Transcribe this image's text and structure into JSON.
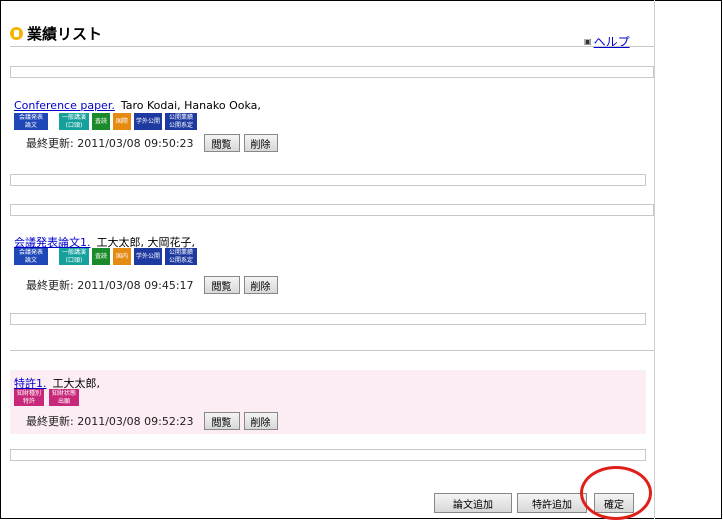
{
  "header": {
    "title": "業績リスト",
    "help_label": "ヘルプ",
    "help_icon": "help-icon"
  },
  "items": [
    {
      "title": "Conference paper.",
      "authors": "Taro Kodai,  Hanako Ooka,",
      "badges": [
        "会議発表 論文",
        "一般講演 (口頭)",
        "査読",
        "国際",
        "学外公開",
        "公開業績 公開系定"
      ],
      "updated_label": "最終更新:",
      "updated": "2011/03/08 09:50:23",
      "view_label": "閲覧",
      "delete_label": "削除"
    },
    {
      "title": "会議発表論文1.",
      "authors": "工大太郎, 大岡花子,",
      "badges": [
        "会議発表 論文",
        "一般講演 (口頭)",
        "査読",
        "国内",
        "学外公開",
        "公開業績 公開系定"
      ],
      "updated_label": "最終更新:",
      "updated": "2011/03/08 09:45:17",
      "view_label": "閲覧",
      "delete_label": "削除"
    },
    {
      "title": "特許1.",
      "authors": "工大太郎,",
      "badges": [
        "知財種別 特許",
        "知財状態 出願"
      ],
      "updated_label": "最終更新:",
      "updated": "2011/03/08 09:52:23",
      "view_label": "閲覧",
      "delete_label": "削除"
    }
  ],
  "footer": {
    "add_paper": "論文追加",
    "add_patent": "特許追加",
    "confirm": "確定"
  },
  "colors": {
    "link": "#0000cc",
    "highlight_circle": "#e0201a",
    "patent_bg": "#fcecf4"
  }
}
